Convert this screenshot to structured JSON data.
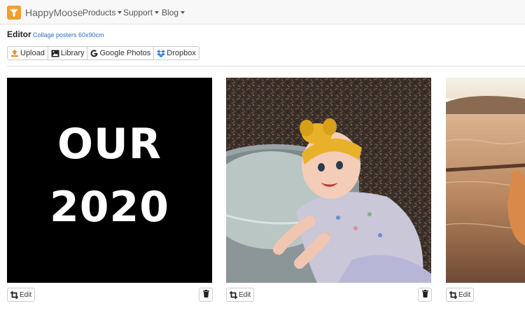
{
  "navbar": {
    "brand": "HappyMoose",
    "items": [
      {
        "label": "Products"
      },
      {
        "label": "Support"
      },
      {
        "label": "Blog"
      }
    ]
  },
  "editor": {
    "title": "Editor",
    "subtitle": "Collage posters 60x90cm"
  },
  "toolbar": {
    "buttons": [
      {
        "label": "Upload",
        "icon": "upload-icon"
      },
      {
        "label": "Library",
        "icon": "image-icon"
      },
      {
        "label": "Google Photos",
        "icon": "google-icon"
      },
      {
        "label": "Dropbox",
        "icon": "dropbox-icon"
      }
    ]
  },
  "photos": [
    {
      "lines": [
        "OUR",
        "2020"
      ],
      "edit_label": "Edit"
    },
    {
      "edit_label": "Edit"
    },
    {
      "edit_label": "Edit"
    }
  ],
  "colors": {
    "brand": "#f0a02c",
    "link": "#2a6ebb",
    "upload": "#e8872a",
    "dropbox": "#2a7de1"
  }
}
